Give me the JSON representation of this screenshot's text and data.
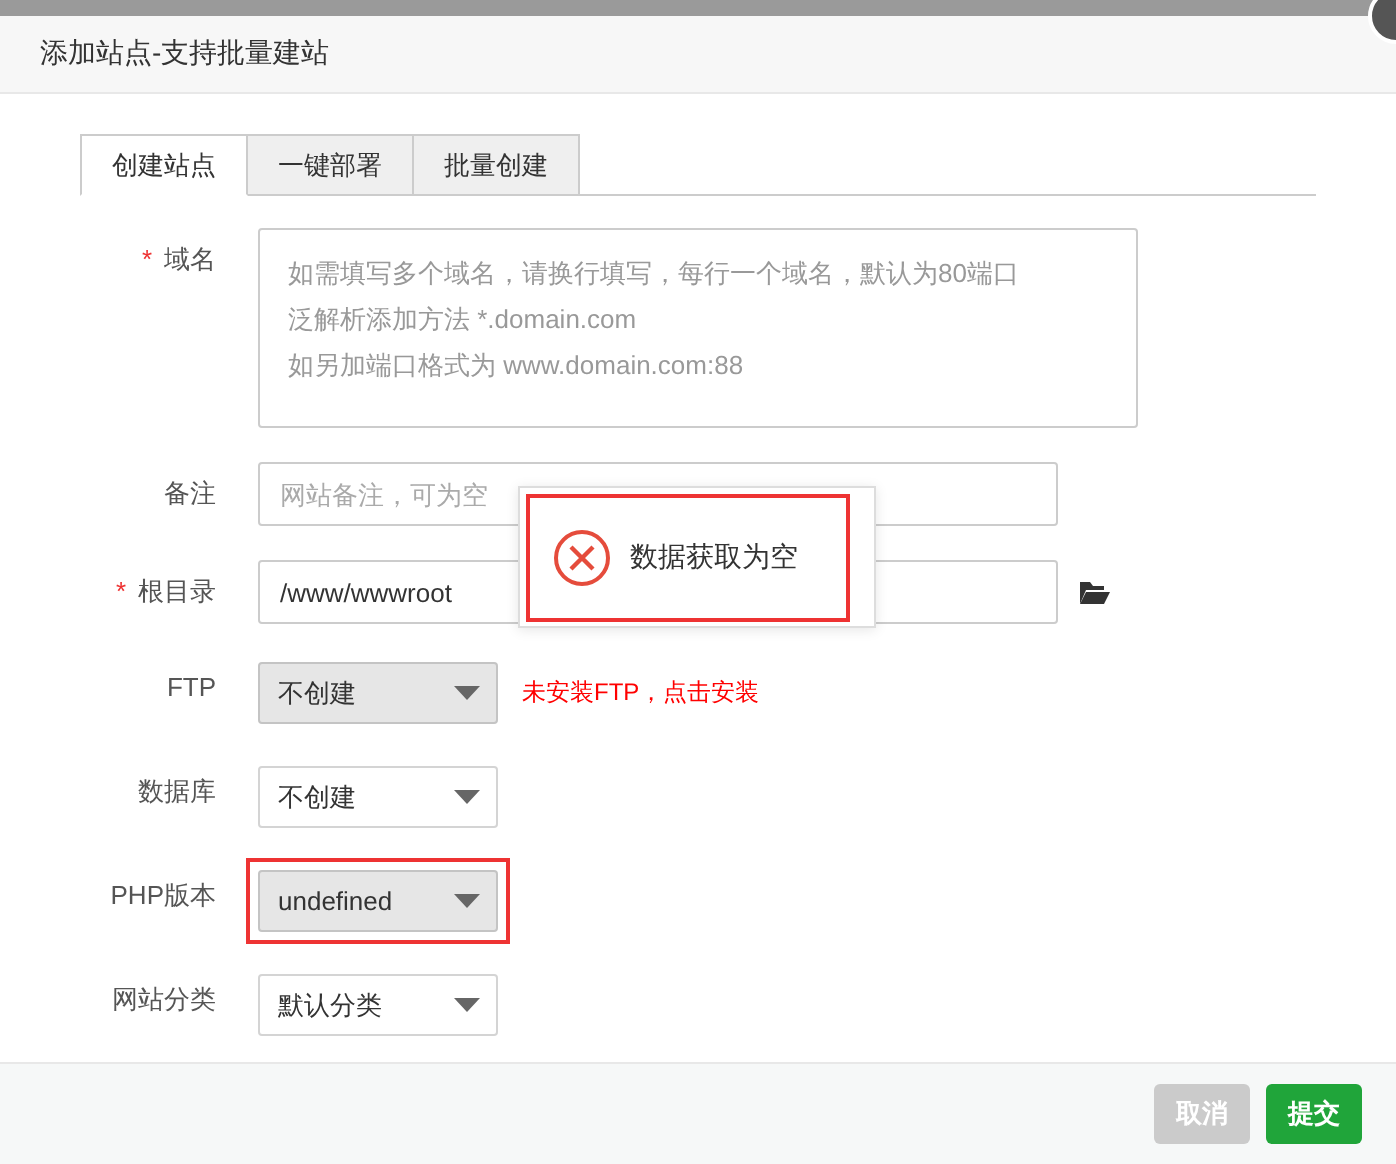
{
  "dialog": {
    "title": "添加站点-支持批量建站",
    "tabs": [
      {
        "label": "创建站点",
        "selected": true
      },
      {
        "label": "一键部署",
        "selected": false
      },
      {
        "label": "批量创建",
        "selected": false
      }
    ],
    "fields": [
      {
        "kind": "textarea",
        "mark": "*",
        "label": "域名",
        "placeholder_lines": [
          "如需填写多个域名，请换行填写，每行一个域名，默认为80端口",
          "泛解析添加方法 *.domain.com",
          "如另加端口格式为 www.domain.com:88"
        ]
      },
      {
        "kind": "input",
        "label": "备注",
        "placeholder": "网站备注，可为空"
      },
      {
        "kind": "path",
        "mark": "*",
        "label": "根目录",
        "value": "/www/wwwroot"
      },
      {
        "kind": "select",
        "label": "FTP",
        "value": "不创建",
        "disabled": true,
        "note": "未安装FTP，点击安装"
      },
      {
        "kind": "select",
        "label": "数据库",
        "value": "不创建",
        "disabled": false
      },
      {
        "kind": "select",
        "label": "PHP版本",
        "value": "undefined",
        "disabled": true,
        "highlighted": true
      },
      {
        "kind": "select",
        "label": "网站分类",
        "value": "默认分类",
        "disabled": false
      }
    ],
    "buttons": [
      {
        "label": "取消",
        "kind": "secondary"
      },
      {
        "label": "提交",
        "kind": "primary"
      }
    ]
  },
  "message": {
    "kind": "error",
    "text": "数据获取为空",
    "highlighted": true
  }
}
